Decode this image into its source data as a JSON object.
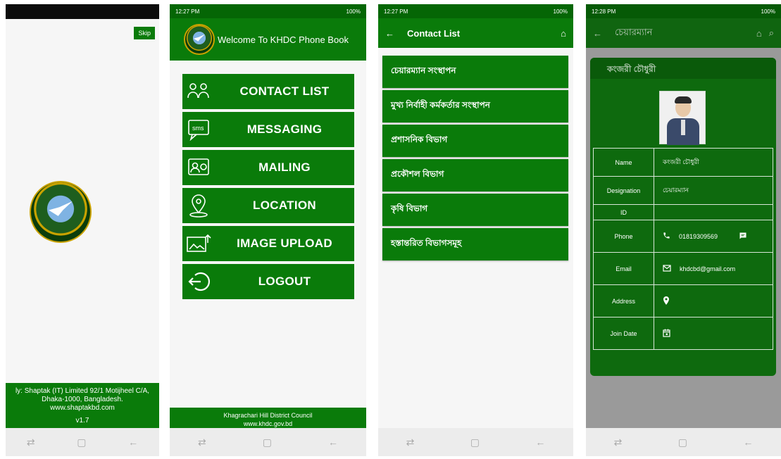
{
  "colors": {
    "primary": "#0a7b0a",
    "dark_primary": "#056605",
    "navbar_bg": "#ececec"
  },
  "splash": {
    "skip_label": "Skip",
    "footer_lines": [
      "ly: Shaptak (IT) Limited 92/1 Motijheel C/A,",
      "Dhaka-1000, Bangladesh.",
      "www.shaptakbd.com"
    ],
    "version": "v1.7",
    "logo_icon": "khdc-logo-icon"
  },
  "home": {
    "status": {
      "time": "12:27 PM",
      "battery": "100%"
    },
    "title": "Welcome To KHDC Phone Book",
    "menu": [
      {
        "label": "CONTACT LIST",
        "icon": "contacts-icon"
      },
      {
        "label": "MESSAGING",
        "icon": "sms-icon"
      },
      {
        "label": "MAILING",
        "icon": "mail-icon"
      },
      {
        "label": "LOCATION",
        "icon": "location-pin-icon"
      },
      {
        "label": "IMAGE UPLOAD",
        "icon": "image-upload-icon"
      },
      {
        "label": "LOGOUT",
        "icon": "logout-icon"
      }
    ],
    "footer_lines": [
      "Khagrachari Hill District Council",
      "www.khdc.gov.bd"
    ]
  },
  "contacts": {
    "status": {
      "time": "12:27 PM",
      "battery": "100%"
    },
    "title": "Contact List",
    "items": [
      "চেয়ারম্যান সংস্থাপন",
      "মুখ্য নির্বাহী কর্মকর্তার সংস্থাপন",
      "প্রশাসনিক বিভাগ",
      "প্রকৌশল বিভাগ",
      "কৃষি বিভাগ",
      "হস্তান্তরিত বিভাগসমূহ"
    ]
  },
  "detail": {
    "status": {
      "time": "12:28 PM",
      "battery": "100%"
    },
    "title": "চেয়ারম্যান",
    "card_title": "কংজরী চৌধুরী",
    "rows": [
      {
        "key": "Name",
        "value": "কংজরী চৌধুরী"
      },
      {
        "key": "Designation",
        "value": "চেয়ারম্যান"
      },
      {
        "key": "ID",
        "value": ""
      },
      {
        "key": "Phone",
        "value": "01819309569"
      },
      {
        "key": "Email",
        "value": "khdcbd@gmail.com"
      },
      {
        "key": "Address",
        "value": ""
      },
      {
        "key": "Join Date",
        "value": ""
      }
    ]
  }
}
